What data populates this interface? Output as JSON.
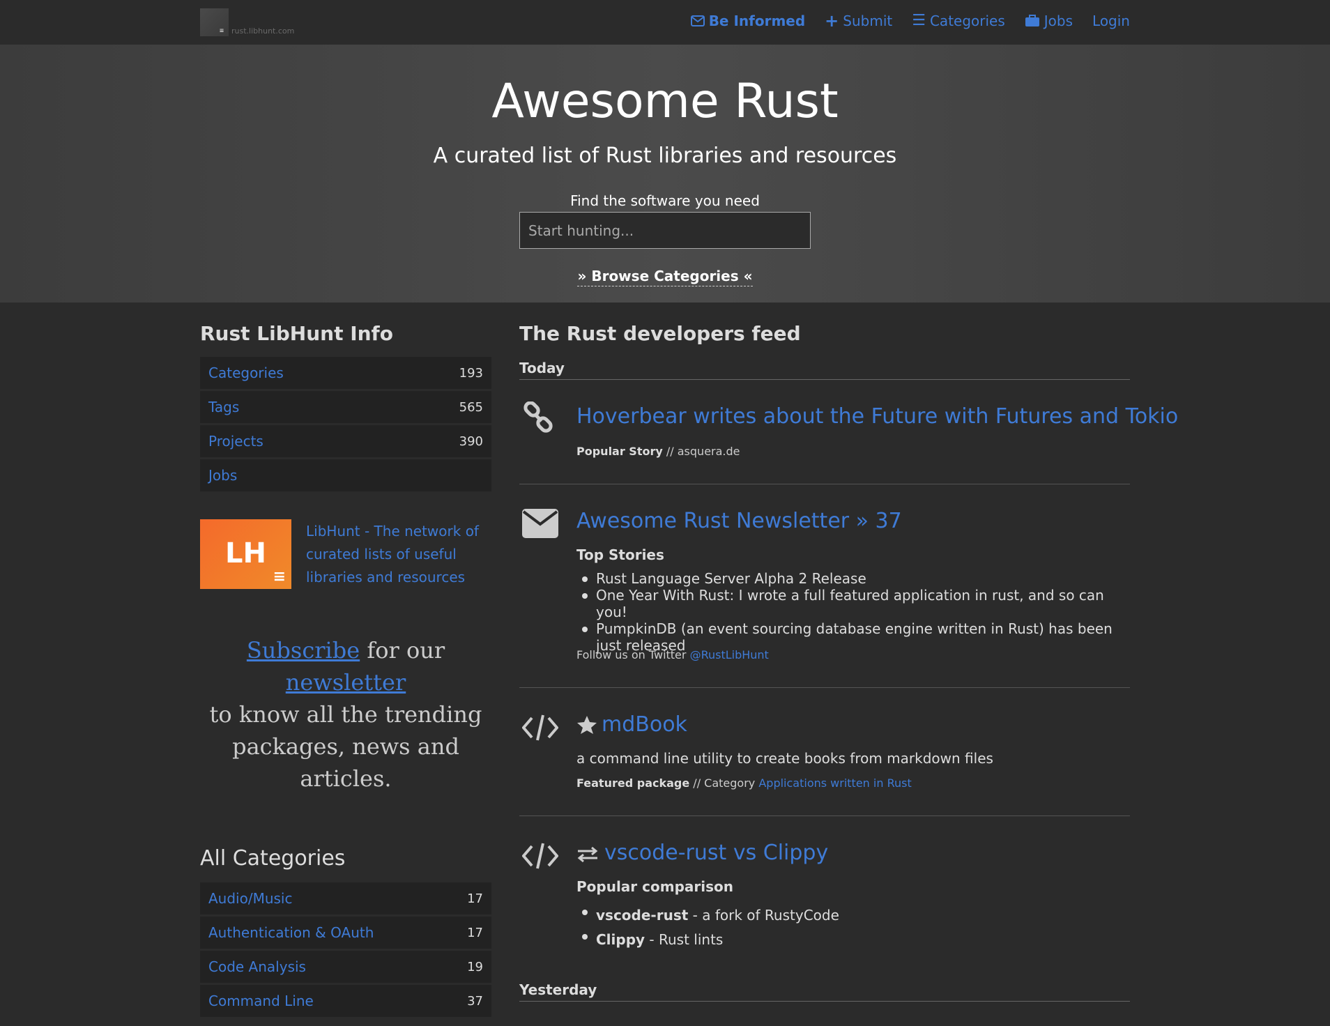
{
  "site": {
    "domain": "rust.libhunt.com"
  },
  "nav": {
    "items": [
      {
        "label": "Be Informed",
        "icon": "envelope-icon"
      },
      {
        "label": "Submit",
        "icon": "plus-icon"
      },
      {
        "label": "Categories",
        "icon": "list-icon"
      },
      {
        "label": "Jobs",
        "icon": "briefcase-icon"
      },
      {
        "label": "Login"
      }
    ]
  },
  "hero": {
    "title": "Awesome Rust",
    "subtitle": "A curated list of Rust libraries and resources",
    "find_label": "Find the software you need",
    "search_placeholder": "Start hunting...",
    "browse": "» Browse Categories «"
  },
  "sidebar": {
    "info_heading": "Rust LibHunt Info",
    "info": [
      {
        "label": "Categories",
        "count": "193"
      },
      {
        "label": "Tags",
        "count": "565"
      },
      {
        "label": "Projects",
        "count": "390"
      },
      {
        "label": "Jobs",
        "count": ""
      }
    ],
    "libhunt_logo": "LH",
    "libhunt_text": "LibHunt - The network of curated lists of useful libraries and resources",
    "subscribe_link": "Subscribe",
    "subscribe_mid": "for our",
    "newsletter_link": "newsletter",
    "subscribe_tail": "to know all the trending packages, news and articles.",
    "categories_heading": "All Categories",
    "categories": [
      {
        "label": "Audio/Music",
        "count": "17"
      },
      {
        "label": "Authentication & OAuth",
        "count": "17"
      },
      {
        "label": "Code Analysis",
        "count": "19"
      },
      {
        "label": "Command Line",
        "count": "37"
      }
    ]
  },
  "feed": {
    "heading": "The Rust developers feed",
    "today": "Today",
    "yesterday": "Yesterday",
    "item1": {
      "title": "Hoverbear writes about the Future with Futures and Tokio",
      "kind": "Popular Story",
      "sep": " // ",
      "source": "asquera.de",
      "icon": "link-icon"
    },
    "item2": {
      "title": "Awesome Rust Newsletter » 37",
      "icon": "envelope-icon",
      "subheading": "Top Stories",
      "stories": [
        "Rust Language Server Alpha 2 Release",
        "One Year With Rust: I wrote a full featured application in rust, and so can you!",
        "PumpkinDB (an event sourcing database engine written in Rust) has been just released"
      ],
      "follow": "Follow us on Twitter",
      "twitter": "@RustLibHunt"
    },
    "item3": {
      "title": "mdBook",
      "icon": "code-icon",
      "desc": "a command line utility to create books from markdown files",
      "kind": "Featured package",
      "sep": " // Category ",
      "category": "Applications written in Rust"
    },
    "item4": {
      "title": "vscode-rust vs Clippy",
      "icon": "code-icon",
      "subheading": "Popular comparison",
      "items": [
        {
          "name": "vscode-rust",
          "desc": " - a fork of RustyCode"
        },
        {
          "name": "Clippy",
          "desc": " - Rust lints"
        }
      ]
    }
  },
  "colors": {
    "link": "#3f7bd6",
    "background": "#2b2b2b",
    "accent_orange": "#f46a2b"
  }
}
